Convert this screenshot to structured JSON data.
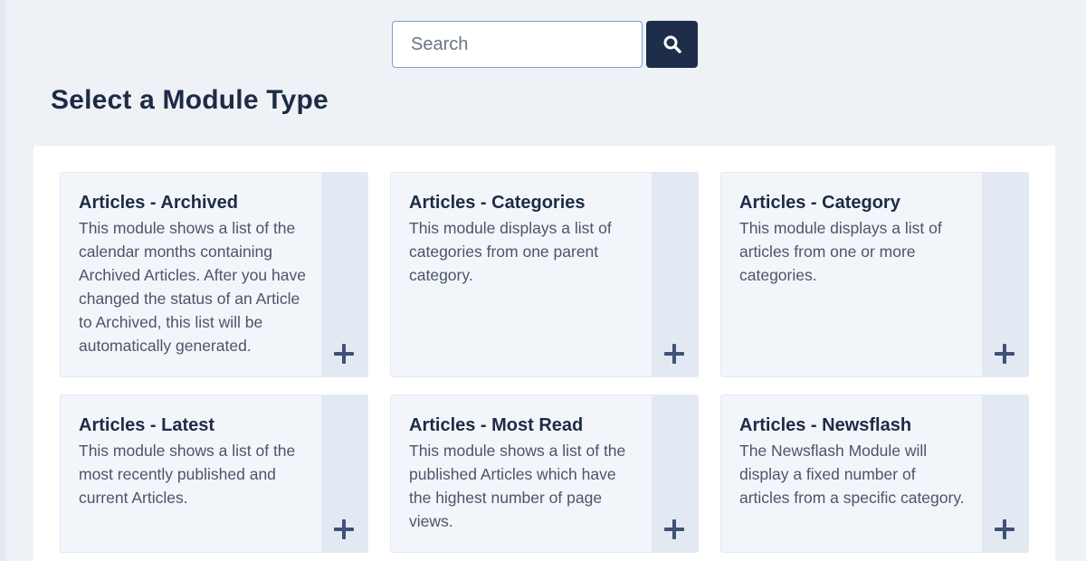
{
  "search": {
    "placeholder": "Search",
    "value": "",
    "button_icon": "search-icon"
  },
  "page_title": "Select a Module Type",
  "modules": [
    {
      "title": "Articles - Archived",
      "description": "This module shows a list of the calendar months containing Archived Articles. After you have changed the status of an Article to Archived, this list will be automatically generated.",
      "action_icon": "plus-icon"
    },
    {
      "title": "Articles - Categories",
      "description": "This module displays a list of categories from one parent category.",
      "action_icon": "plus-icon"
    },
    {
      "title": "Articles - Category",
      "description": "This module displays a list of articles from one or more categories.",
      "action_icon": "plus-icon"
    },
    {
      "title": "Articles - Latest",
      "description": "This module shows a list of the most recently published and current Articles.",
      "action_icon": "plus-icon"
    },
    {
      "title": "Articles - Most Read",
      "description": "This module shows a list of the published Articles which have the highest number of page views.",
      "action_icon": "plus-icon"
    },
    {
      "title": "Articles - Newsflash",
      "description": "The Newsflash Module will display a fixed number of articles from a specific category.",
      "action_icon": "plus-icon"
    }
  ],
  "colors": {
    "page_background": "#eef2f7",
    "search_button": "#1e2e4a",
    "card_background": "#f2f6fb",
    "card_action_strip": "#e3e9f2",
    "icon": "#3d5275"
  }
}
